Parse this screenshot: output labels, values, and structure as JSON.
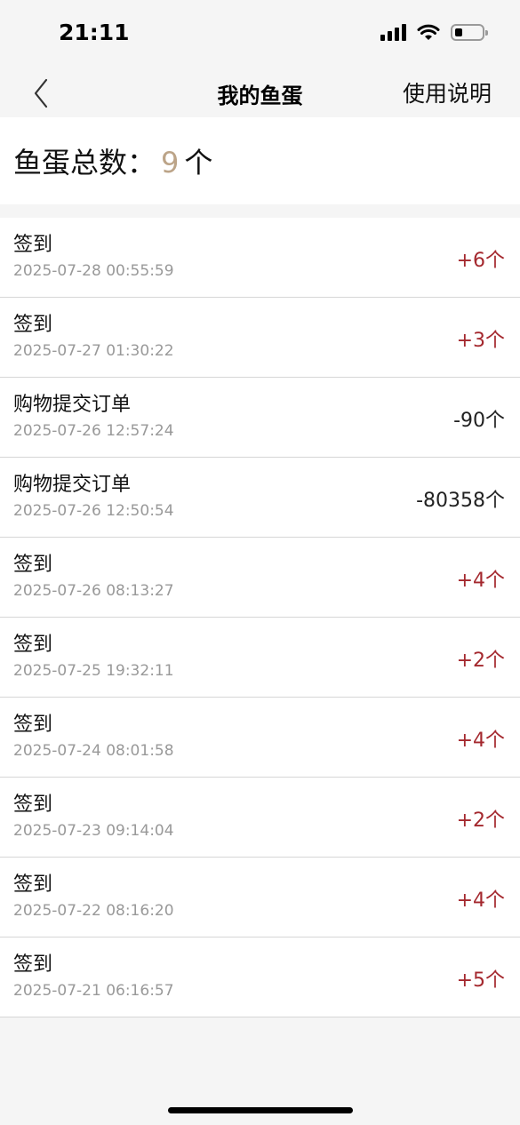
{
  "status_bar": {
    "time": "21:11",
    "icons": [
      "signal-icon",
      "wifi-icon",
      "battery-icon"
    ]
  },
  "nav": {
    "back_icon": "chevron-left-icon",
    "title": "我的鱼蛋",
    "help_label": "使用说明"
  },
  "summary": {
    "label": "鱼蛋总数：",
    "count": "9",
    "unit": "个"
  },
  "records": [
    {
      "title": "签到",
      "time": "2025-07-28 00:55:59",
      "amount": "+6个",
      "type": "positive"
    },
    {
      "title": "签到",
      "time": "2025-07-27 01:30:22",
      "amount": "+3个",
      "type": "positive"
    },
    {
      "title": "购物提交订单",
      "time": "2025-07-26 12:57:24",
      "amount": "-90个",
      "type": "negative"
    },
    {
      "title": "购物提交订单",
      "time": "2025-07-26 12:50:54",
      "amount": "-80358个",
      "type": "negative"
    },
    {
      "title": "签到",
      "time": "2025-07-26 08:13:27",
      "amount": "+4个",
      "type": "positive"
    },
    {
      "title": "签到",
      "time": "2025-07-25 19:32:11",
      "amount": "+2个",
      "type": "positive"
    },
    {
      "title": "签到",
      "time": "2025-07-24 08:01:58",
      "amount": "+4个",
      "type": "positive"
    },
    {
      "title": "签到",
      "time": "2025-07-23 09:14:04",
      "amount": "+2个",
      "type": "positive"
    },
    {
      "title": "签到",
      "time": "2025-07-22 08:16:20",
      "amount": "+4个",
      "type": "positive"
    },
    {
      "title": "签到",
      "time": "2025-07-21 06:16:57",
      "amount": "+5个",
      "type": "positive"
    }
  ],
  "colors": {
    "positive": "#a4282e",
    "negative": "#222222",
    "count_accent": "#bca488"
  }
}
